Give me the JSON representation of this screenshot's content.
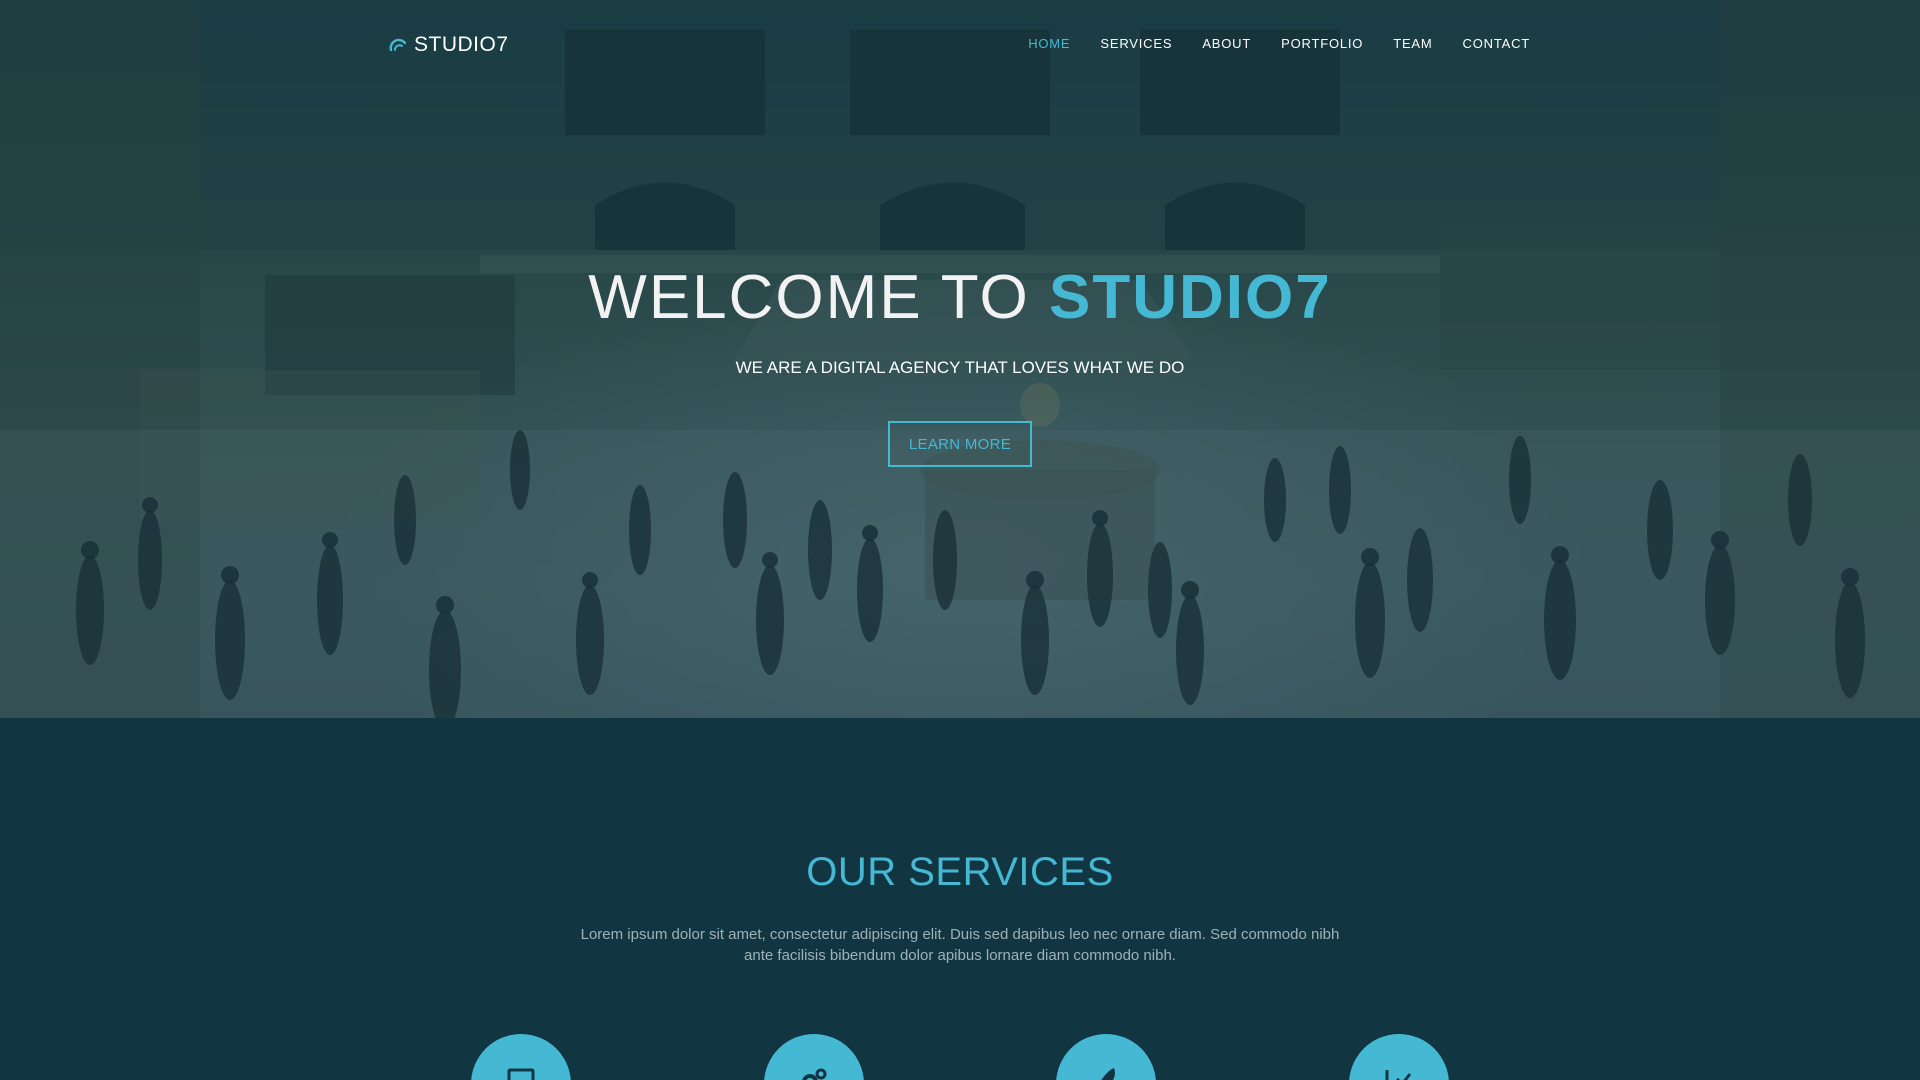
{
  "brand": {
    "name": "STUDIO7",
    "icon": "studio-arc-logo-icon"
  },
  "nav": {
    "items": [
      {
        "label": "HOME",
        "active": true
      },
      {
        "label": "SERVICES",
        "active": false
      },
      {
        "label": "ABOUT",
        "active": false
      },
      {
        "label": "PORTFOLIO",
        "active": false
      },
      {
        "label": "TEAM",
        "active": false
      },
      {
        "label": "CONTACT",
        "active": false
      }
    ]
  },
  "hero": {
    "title_prefix": "WELCOME TO",
    "title_accent": "STUDIO7",
    "subtitle": "WE ARE A DIGITAL AGENCY THAT LOVES WHAT WE DO",
    "button_label": "LEARN MORE",
    "background": "train-station-concourse-photo"
  },
  "services": {
    "title": "OUR SERVICES",
    "description": "Lorem ipsum dolor sit amet, consectetur adipiscing elit. Duis sed dapibus leo nec ornare diam. Sed commodo nibh ante facilisis bibendum dolor apibus lornare diam commodo nibh.",
    "icons": [
      "laptop-icon",
      "gears-icon",
      "rocket-icon",
      "chart-icon"
    ]
  },
  "colors": {
    "accent": "#45b8d4",
    "background": "#113642",
    "muted_text": "#9fb1b8"
  }
}
